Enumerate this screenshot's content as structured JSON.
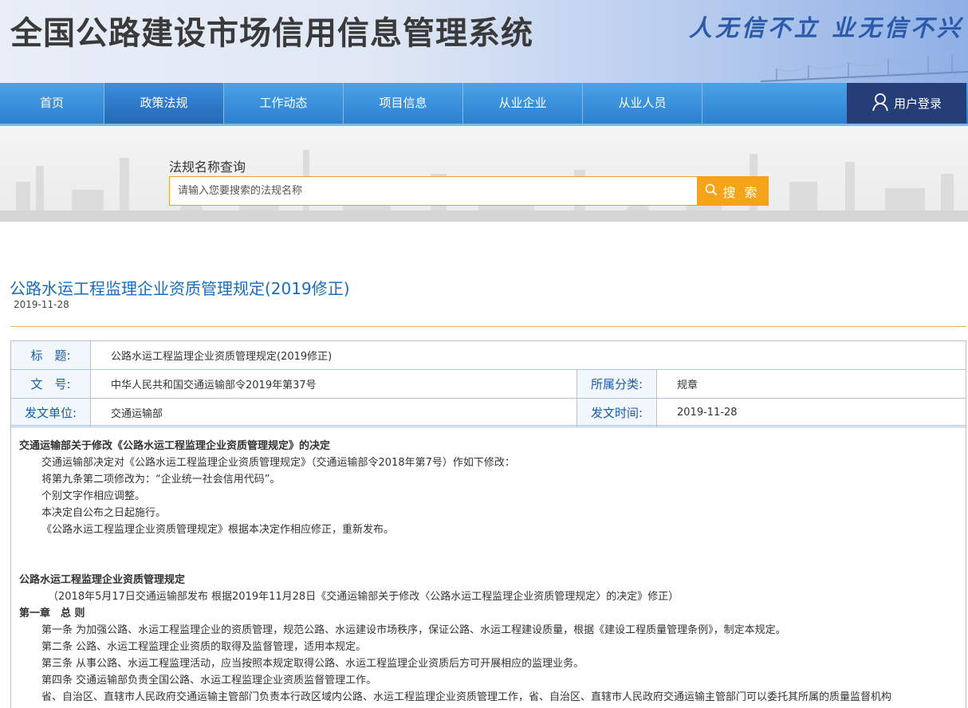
{
  "header": {
    "site_title": "全国公路建设市场信用信息管理系统",
    "slogan": "人无信不立 业无信不兴"
  },
  "nav": {
    "items": [
      {
        "label": "首页"
      },
      {
        "label": "政策法规"
      },
      {
        "label": "工作动态"
      },
      {
        "label": "项目信息"
      },
      {
        "label": "从业企业"
      },
      {
        "label": "从业人员"
      }
    ],
    "login_label": "用户登录"
  },
  "search": {
    "label": "法规名称查询",
    "placeholder": "请输入您要搜索的法规名称",
    "button_label": "搜 索"
  },
  "article": {
    "title": "公路水运工程监理企业资质管理规定(2019修正)",
    "date": "2019-11-28",
    "meta": {
      "title_label": "标　题:",
      "title_value": "公路水运工程监理企业资质管理规定(2019修正)",
      "docno_label": "文　号:",
      "docno_value": "中华人民共和国交通运输部令2019年第37号",
      "category_label": "所属分类:",
      "category_value": "规章",
      "issuer_label": "发文单位:",
      "issuer_value": "交通运输部",
      "issue_time_label": "发文时间:",
      "issue_time_value": "2019-11-28"
    },
    "body": {
      "decision_heading": "交通运输部关于修改《公路水运工程监理企业资质管理规定》的决定",
      "decision_lines": [
        "交通运输部决定对《公路水运工程监理企业资质管理规定》（交通运输部令2018年第7号）作如下修改：",
        "将第九条第二项修改为：“企业统一社会信用代码”。",
        "个别文字作相应调整。",
        "本决定自公布之日起施行。",
        "《公路水运工程监理企业资质管理规定》根据本决定作相应修正，重新发布。"
      ],
      "rule_heading": "公路水运工程监理企业资质管理规定",
      "rule_note": "（2018年5月17日交通运输部发布 根据2019年11月28日《交通运输部关于修改〈公路水运工程监理企业资质管理规定〉的决定》修正）",
      "chapter_heading": "第一章　总 则",
      "articles": [
        "第一条 为加强公路、水运工程监理企业的资质管理，规范公路、水运建设市场秩序，保证公路、水运工程建设质量，根据《建设工程质量管理条例》，制定本规定。",
        "第二条 公路、水运工程监理企业资质的取得及监督管理，适用本规定。",
        "第三条 从事公路、水运工程监理活动，应当按照本规定取得公路、水运工程监理企业资质后方可开展相应的监理业务。",
        "第四条 交通运输部负责全国公路、水运工程监理企业资质监督管理工作。",
        "省、自治区、直辖市人民政府交通运输主管部门负责本行政区域内公路、水运工程监理企业资质管理工作，省、自治区、直辖市人民政府交通运输主管部门可以委托其所属的质量监督机构"
      ]
    }
  },
  "colors": {
    "nav_blue": "#2d7fd0",
    "login_bg": "#263e78",
    "search_orange": "#f5a31a",
    "title_blue": "#1a6cbc"
  }
}
